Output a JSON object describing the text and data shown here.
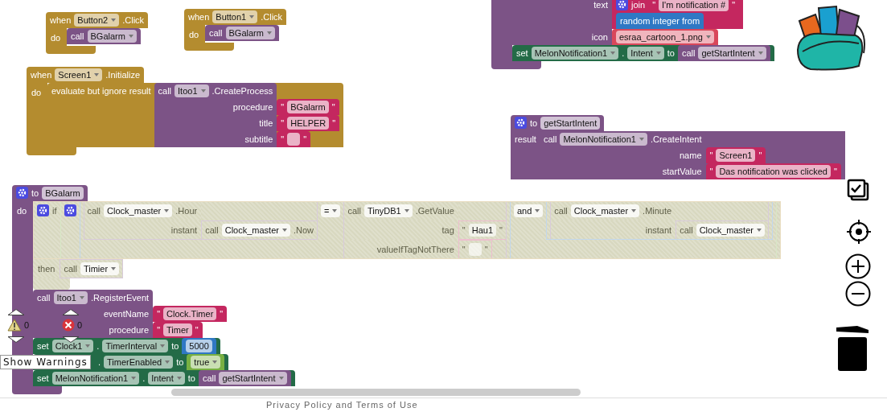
{
  "blocks": [
    {
      "kind": "event",
      "head": [
        {
          "kind": "label",
          "text": "when"
        },
        {
          "kind": "dropdown",
          "text": "Button2"
        },
        {
          "kind": "label",
          "text": ".Click"
        }
      ],
      "body_label": "do",
      "body": [
        {
          "kind": "procedure",
          "head": [
            {
              "kind": "label",
              "text": "call"
            },
            {
              "kind": "dropdown",
              "text": "BGalarm"
            }
          ]
        }
      ]
    },
    {
      "kind": "event",
      "head": [
        {
          "kind": "label",
          "text": "when"
        },
        {
          "kind": "dropdown",
          "text": "Button1"
        },
        {
          "kind": "label",
          "text": ".Click"
        }
      ],
      "body_label": "do",
      "body": [
        {
          "kind": "procedure",
          "head": [
            {
              "kind": "label",
              "text": "call"
            },
            {
              "kind": "dropdown",
              "text": "BGalarm"
            }
          ]
        }
      ]
    },
    {
      "kind": "event",
      "head": [
        {
          "kind": "label",
          "text": "when"
        },
        {
          "kind": "dropdown",
          "text": "Screen1"
        },
        {
          "kind": "label",
          "text": ".Initialize"
        }
      ],
      "body_label": "do",
      "body": [
        {
          "kind": "control",
          "head": [
            {
              "kind": "label",
              "text": "evaluate but ignore result"
            },
            {
              "kind": "input",
              "block": {
                "kind": "component",
                "head": [
                  {
                    "kind": "label",
                    "text": "call"
                  },
                  {
                    "kind": "dropdown",
                    "text": "Itoo1"
                  },
                  {
                    "kind": "label",
                    "text": ".CreateProcess"
                  }
                ],
                "inputs": [
                  {
                    "label": "procedure",
                    "block": {
                      "kind": "text",
                      "head": [
                        {
                          "kind": "quote",
                          "text": "\""
                        },
                        {
                          "kind": "field",
                          "text": "BGalarm"
                        },
                        {
                          "kind": "quote",
                          "text": "\""
                        }
                      ]
                    }
                  },
                  {
                    "label": "title",
                    "block": {
                      "kind": "text",
                      "head": [
                        {
                          "kind": "quote",
                          "text": "\""
                        },
                        {
                          "kind": "field",
                          "text": "HELPER"
                        },
                        {
                          "kind": "quote",
                          "text": "\""
                        }
                      ]
                    }
                  },
                  {
                    "label": "subtitle",
                    "block": {
                      "kind": "text",
                      "head": [
                        {
                          "kind": "quote",
                          "text": "\""
                        },
                        {
                          "kind": "blank"
                        },
                        {
                          "kind": "quote",
                          "text": "\""
                        }
                      ]
                    }
                  }
                ]
              }
            }
          ]
        }
      ]
    },
    {
      "kind": "procedure",
      "inputs": [
        {
          "label": "text",
          "block": {
            "kind": "text",
            "head": [
              {
                "kind": "gear"
              },
              {
                "kind": "label",
                "text": "join"
              },
              {
                "kind": "input",
                "block": {
                  "kind": "text",
                  "head": [
                    {
                      "kind": "quote",
                      "text": "\""
                    },
                    {
                      "kind": "field",
                      "text": "I'm notification #"
                    },
                    {
                      "kind": "quote",
                      "text": "\""
                    }
                  ]
                }
              }
            ],
            "inputs": [
              {
                "block": {
                  "kind": "math",
                  "head": [
                    {
                      "kind": "label",
                      "text": "random integer from"
                    }
                  ]
                }
              }
            ]
          }
        },
        {
          "label": "icon",
          "block": {
            "kind": "asset",
            "head": [
              {
                "kind": "dropdown",
                "text": "esraa_cartoon_1.png"
              }
            ]
          }
        }
      ],
      "body": [
        {
          "kind": "setter",
          "head": [
            {
              "kind": "label",
              "text": "set"
            },
            {
              "kind": "dropdown",
              "text": "MelonNotification1"
            },
            {
              "kind": "label",
              "text": "."
            },
            {
              "kind": "dropdown",
              "text": "Intent"
            },
            {
              "kind": "label",
              "text": "to"
            },
            {
              "kind": "input",
              "block": {
                "kind": "procedure",
                "head": [
                  {
                    "kind": "label",
                    "text": "call"
                  },
                  {
                    "kind": "dropdown",
                    "text": "getStartIntent"
                  }
                ]
              }
            }
          ]
        }
      ]
    },
    {
      "kind": "procedure",
      "head": [
        {
          "kind": "gear"
        },
        {
          "kind": "label",
          "text": "to"
        },
        {
          "kind": "field",
          "text": "getStartIntent"
        }
      ],
      "inputs": [
        {
          "label": "result",
          "block": {
            "kind": "component",
            "head": [
              {
                "kind": "label",
                "text": "call"
              },
              {
                "kind": "dropdown",
                "text": "MelonNotification1"
              },
              {
                "kind": "label",
                "text": ".CreateIntent"
              }
            ],
            "inputs": [
              {
                "label": "name",
                "block": {
                  "kind": "text",
                  "head": [
                    {
                      "kind": "quote",
                      "text": "\""
                    },
                    {
                      "kind": "field",
                      "text": "Screen1"
                    },
                    {
                      "kind": "quote",
                      "text": "\""
                    }
                  ]
                }
              },
              {
                "label": "startValue",
                "block": {
                  "kind": "text",
                  "head": [
                    {
                      "kind": "quote",
                      "text": "\""
                    },
                    {
                      "kind": "field",
                      "text": "Das notification was clicked"
                    },
                    {
                      "kind": "quote",
                      "text": "\""
                    }
                  ]
                }
              }
            ]
          }
        }
      ]
    },
    {
      "kind": "procedure",
      "head": [
        {
          "kind": "gear"
        },
        {
          "kind": "label",
          "text": "to"
        },
        {
          "kind": "field",
          "text": "BGalarm"
        }
      ],
      "body_label": "do",
      "body": [
        {
          "kind": "control",
          "disabled": true,
          "head": [
            {
              "kind": "gear"
            },
            {
              "kind": "label",
              "text": "if"
            },
            {
              "kind": "input",
              "block": {
                "kind": "logic",
                "head": [
                  {
                    "kind": "gear"
                  },
                  {
                    "kind": "input",
                    "block": {
                      "kind": "math",
                      "head": [
                        {
                          "kind": "input",
                          "block": {
                            "kind": "component",
                            "head": [
                              {
                                "kind": "label",
                                "text": "call"
                              },
                              {
                                "kind": "dropdown",
                                "text": "Clock_master"
                              },
                              {
                                "kind": "label",
                                "text": ".Hour"
                              }
                            ],
                            "inputs": [
                              {
                                "label": "instant",
                                "block": {
                                  "kind": "component",
                                  "head": [
                                    {
                                      "kind": "label",
                                      "text": "call"
                                    },
                                    {
                                      "kind": "dropdown",
                                      "text": "Clock_master"
                                    },
                                    {
                                      "kind": "label",
                                      "text": ".Now"
                                    }
                                  ]
                                }
                              }
                            ]
                          }
                        },
                        {
                          "kind": "dropdown",
                          "text": "="
                        },
                        {
                          "kind": "input",
                          "block": {
                            "kind": "component",
                            "head": [
                              {
                                "kind": "label",
                                "text": "call"
                              },
                              {
                                "kind": "dropdown",
                                "text": "TinyDB1"
                              },
                              {
                                "kind": "label",
                                "text": ".GetValue"
                              }
                            ],
                            "inputs": [
                              {
                                "label": "tag",
                                "block": {
                                  "kind": "text",
                                  "head": [
                                    {
                                      "kind": "quote",
                                      "text": "\""
                                    },
                                    {
                                      "kind": "field",
                                      "text": "Hau1"
                                    },
                                    {
                                      "kind": "quote",
                                      "text": "\""
                                    }
                                  ]
                                }
                              },
                              {
                                "label": "valueIfTagNotThere",
                                "block": {
                                  "kind": "text",
                                  "head": [
                                    {
                                      "kind": "quote",
                                      "text": "\""
                                    },
                                    {
                                      "kind": "blank"
                                    },
                                    {
                                      "kind": "quote",
                                      "text": "\""
                                    }
                                  ]
                                }
                              }
                            ]
                          }
                        }
                      ]
                    }
                  },
                  {
                    "kind": "dropdown",
                    "text": "and"
                  },
                  {
                    "kind": "input",
                    "block": {
                      "kind": "math",
                      "head": [
                        {
                          "kind": "input",
                          "block": {
                            "kind": "component",
                            "head": [
                              {
                                "kind": "label",
                                "text": "call"
                              },
                              {
                                "kind": "dropdown",
                                "text": "Clock_master"
                              },
                              {
                                "kind": "label",
                                "text": ".Minute"
                              }
                            ],
                            "inputs": [
                              {
                                "label": "instant",
                                "block": {
                                  "kind": "component",
                                  "head": [
                                    {
                                      "kind": "label",
                                      "text": "call"
                                    },
                                    {
                                      "kind": "dropdown",
                                      "text": "Clock_master"
                                    }
                                  ]
                                }
                              }
                            ]
                          }
                        }
                      ]
                    }
                  }
                ]
              }
            }
          ],
          "body_label": "then",
          "body": [
            {
              "kind": "procedure",
              "head": [
                {
                  "kind": "label",
                  "text": "call"
                },
                {
                  "kind": "dropdown",
                  "text": "Timier"
                }
              ]
            }
          ]
        },
        {
          "kind": "component",
          "head": [
            {
              "kind": "label",
              "text": "call"
            },
            {
              "kind": "dropdown",
              "text": "Itoo1"
            },
            {
              "kind": "label",
              "text": ".RegisterEvent"
            }
          ],
          "inputs": [
            {
              "label": "eventName",
              "block": {
                "kind": "text",
                "head": [
                  {
                    "kind": "quote",
                    "text": "\""
                  },
                  {
                    "kind": "field",
                    "text": "Clock.Timer"
                  },
                  {
                    "kind": "quote",
                    "text": "\""
                  }
                ]
              }
            },
            {
              "label": "procedure",
              "block": {
                "kind": "text",
                "head": [
                  {
                    "kind": "quote",
                    "text": "\""
                  },
                  {
                    "kind": "field",
                    "text": "Timer"
                  },
                  {
                    "kind": "quote",
                    "text": "\""
                  }
                ]
              }
            }
          ]
        },
        {
          "kind": "setter",
          "head": [
            {
              "kind": "label",
              "text": "set"
            },
            {
              "kind": "dropdown",
              "text": "Clock1"
            },
            {
              "kind": "label",
              "text": "."
            },
            {
              "kind": "dropdown",
              "text": "TimerInterval"
            },
            {
              "kind": "label",
              "text": "to"
            },
            {
              "kind": "input",
              "block": {
                "kind": "math",
                "head": [
                  {
                    "kind": "field",
                    "text": "5000"
                  }
                ]
              }
            }
          ]
        },
        {
          "kind": "setter",
          "head": [
            {
              "kind": "spacer"
            },
            {
              "kind": "label",
              "text": "."
            },
            {
              "kind": "dropdown",
              "text": "TimerEnabled"
            },
            {
              "kind": "label",
              "text": "to"
            },
            {
              "kind": "input",
              "block": {
                "kind": "logic",
                "head": [
                  {
                    "kind": "dropdown",
                    "text": "true"
                  }
                ]
              }
            }
          ]
        },
        {
          "kind": "setter",
          "head": [
            {
              "kind": "label",
              "text": "set"
            },
            {
              "kind": "dropdown",
              "text": "MelonNotification1"
            },
            {
              "kind": "label",
              "text": "."
            },
            {
              "kind": "dropdown",
              "text": "Intent"
            },
            {
              "kind": "label",
              "text": "to"
            },
            {
              "kind": "input",
              "block": {
                "kind": "procedure",
                "head": [
                  {
                    "kind": "label",
                    "text": "call"
                  },
                  {
                    "kind": "dropdown",
                    "text": "getStartIntent"
                  }
                ]
              }
            }
          ]
        }
      ]
    }
  ],
  "indicators": {
    "warnings": {
      "count": "0"
    },
    "errors": {
      "count": "0"
    },
    "tooltip": "Show Warnings"
  },
  "footer": "Privacy Policy and Terms of Use"
}
